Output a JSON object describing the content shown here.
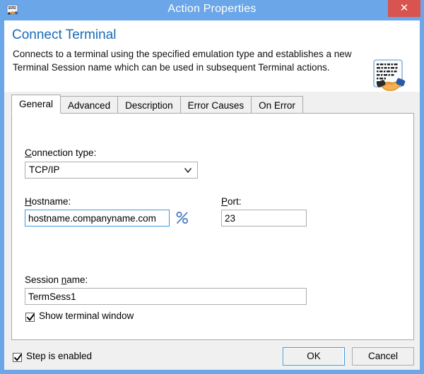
{
  "window": {
    "title": "Action Properties",
    "icon": "terminal-handshake-icon",
    "close_label": "✕",
    "frame_color": "#6aa6e8",
    "close_color": "#d9534f"
  },
  "header": {
    "title": "Connect Terminal",
    "title_color": "#1a6bb5",
    "description": "Connects to a terminal using the specified emulation type and establishes a new Terminal Session name which can be used in subsequent Terminal actions.",
    "icon": "terminal-handshake-icon"
  },
  "tabs": [
    {
      "label": "General",
      "active": true
    },
    {
      "label": "Advanced",
      "active": false
    },
    {
      "label": "Description",
      "active": false
    },
    {
      "label": "Error Causes",
      "active": false
    },
    {
      "label": "On Error",
      "active": false
    }
  ],
  "form": {
    "connection_type": {
      "label_pre": "",
      "label_acc": "C",
      "label_post": "onnection type:",
      "value": "TCP/IP",
      "arrow_icon": "chevron-down-icon"
    },
    "hostname": {
      "label_pre": "",
      "label_acc": "H",
      "label_post": "ostname:",
      "value": "hostname.companyname.com",
      "focused": true,
      "variable_button_icon": "percent-icon",
      "variable_button_label": "%"
    },
    "port": {
      "label_pre": "",
      "label_acc": "P",
      "label_post": "ort:",
      "value": "23"
    },
    "session_name": {
      "label_pre": "Session ",
      "label_acc": "n",
      "label_post": "ame:",
      "value": "TermSess1"
    },
    "show_terminal_window": {
      "label": "Show terminal window",
      "checked": true
    }
  },
  "footer": {
    "step_enabled": {
      "label": "Step is enabled",
      "checked": true
    },
    "ok_label": "OK",
    "cancel_label": "Cancel"
  }
}
